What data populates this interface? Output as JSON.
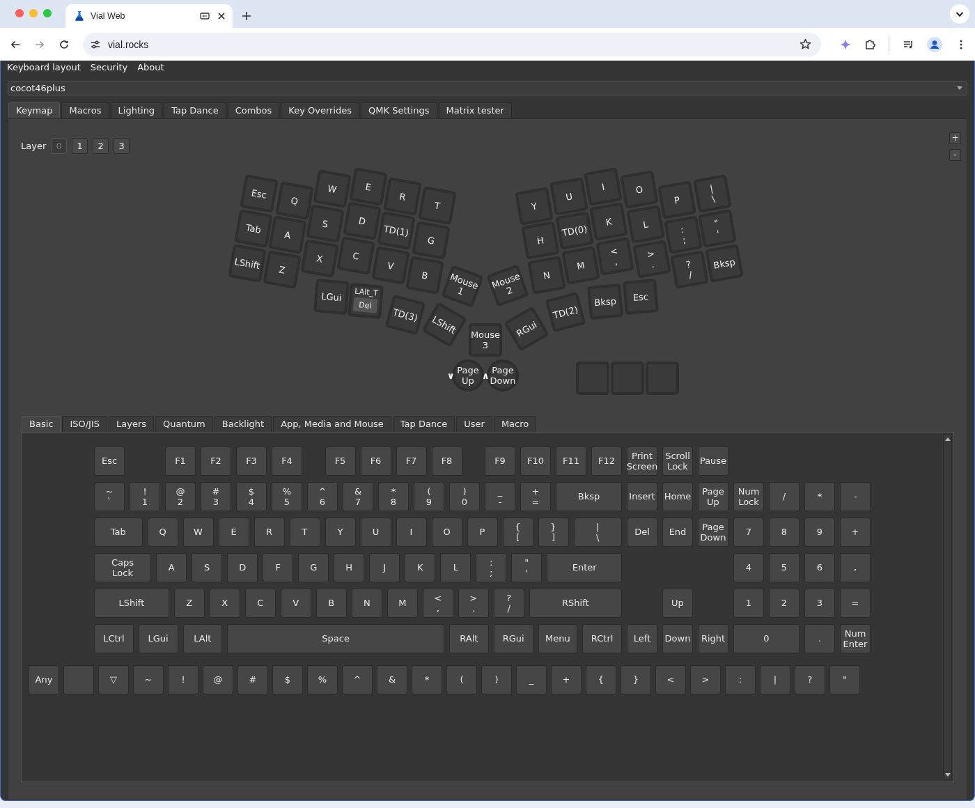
{
  "browser": {
    "tab_title": "Vial Web",
    "url": "vial.rocks"
  },
  "menu": [
    "Keyboard layout",
    "Security",
    "About"
  ],
  "keyboard_select": {
    "value": "cocot46plus"
  },
  "tabs": [
    {
      "label": "Keymap",
      "selected": true
    },
    {
      "label": "Macros",
      "selected": false
    },
    {
      "label": "Lighting",
      "selected": false
    },
    {
      "label": "Tap Dance",
      "selected": false
    },
    {
      "label": "Combos",
      "selected": false
    },
    {
      "label": "Key Overrides",
      "selected": false
    },
    {
      "label": "QMK Settings",
      "selected": false
    },
    {
      "label": "Matrix tester",
      "selected": false
    }
  ],
  "layers": {
    "label": "Layer",
    "buttons": [
      {
        "label": "0",
        "selected": true
      },
      {
        "label": "1",
        "selected": false
      },
      {
        "label": "2",
        "selected": false
      },
      {
        "label": "3",
        "selected": false
      }
    ]
  },
  "zoom_buttons": [
    "+",
    "-"
  ],
  "layout_keys": [
    {
      "kind": "key",
      "label": "Esc"
    },
    {
      "kind": "key",
      "label": "Q"
    },
    {
      "kind": "key",
      "label": "W"
    },
    {
      "kind": "key",
      "label": "E"
    },
    {
      "kind": "key",
      "label": "R"
    },
    {
      "kind": "key",
      "label": "T"
    },
    {
      "kind": "key",
      "label": "Tab"
    },
    {
      "kind": "key",
      "label": "A"
    },
    {
      "kind": "key",
      "label": "S"
    },
    {
      "kind": "key",
      "label": "D"
    },
    {
      "kind": "key",
      "label": "TD(1)"
    },
    {
      "kind": "key",
      "label": "G"
    },
    {
      "kind": "key",
      "label": "LShift"
    },
    {
      "kind": "key",
      "label": "Z"
    },
    {
      "kind": "key",
      "label": "X"
    },
    {
      "kind": "key",
      "label": "C"
    },
    {
      "kind": "key",
      "label": "V"
    },
    {
      "kind": "key",
      "label": "B"
    },
    {
      "kind": "key",
      "label": "Mouse\n1"
    },
    {
      "kind": "key",
      "label": "LGui"
    },
    {
      "kind": "modtap",
      "label": "LAlt_T",
      "tap": "Del"
    },
    {
      "kind": "key",
      "label": "TD(3)"
    },
    {
      "kind": "key",
      "label": "LShift"
    },
    {
      "kind": "key",
      "label": "Mouse\n3"
    },
    {
      "kind": "key",
      "label": "Y"
    },
    {
      "kind": "key",
      "label": "U"
    },
    {
      "kind": "key",
      "label": "I"
    },
    {
      "kind": "key",
      "label": "O"
    },
    {
      "kind": "key",
      "label": "P"
    },
    {
      "kind": "key",
      "label": "|\n\\"
    },
    {
      "kind": "key",
      "label": "H"
    },
    {
      "kind": "key",
      "label": "TD(0)"
    },
    {
      "kind": "key",
      "label": "K"
    },
    {
      "kind": "key",
      "label": "L"
    },
    {
      "kind": "key",
      "label": ":\n;"
    },
    {
      "kind": "key",
      "label": "\"\n'"
    },
    {
      "kind": "key",
      "label": "N"
    },
    {
      "kind": "key",
      "label": "M"
    },
    {
      "kind": "key",
      "label": "<\n,"
    },
    {
      "kind": "key",
      "label": ">\n."
    },
    {
      "kind": "key",
      "label": "?\n/"
    },
    {
      "kind": "key",
      "label": "Bksp"
    },
    {
      "kind": "key",
      "label": "Mouse\n2"
    },
    {
      "kind": "key",
      "label": "RGui"
    },
    {
      "kind": "key",
      "label": "TD(2)"
    },
    {
      "kind": "key",
      "label": "Bksp"
    },
    {
      "kind": "key",
      "label": "Esc"
    },
    {
      "kind": "encoder",
      "label": "Page\nUp",
      "arrow": "∨"
    },
    {
      "kind": "encoder",
      "label": "Page\nDown",
      "arrow": "∧"
    },
    {
      "kind": "blank"
    },
    {
      "kind": "blank"
    },
    {
      "kind": "blank"
    }
  ],
  "keycode_tabs": [
    {
      "label": "Basic",
      "selected": true
    },
    {
      "label": "ISO/JIS",
      "selected": false
    },
    {
      "label": "Layers",
      "selected": false
    },
    {
      "label": "Quantum",
      "selected": false
    },
    {
      "label": "Backlight",
      "selected": false
    },
    {
      "label": "App, Media and Mouse",
      "selected": false
    },
    {
      "label": "Tap Dance",
      "selected": false
    },
    {
      "label": "User",
      "selected": false
    },
    {
      "label": "Macro",
      "selected": false
    }
  ],
  "keycode_rows": [
    [
      "Esc",
      "F1",
      "F2",
      "F3",
      "F4",
      "F5",
      "F6",
      "F7",
      "F8",
      "F9",
      "F10",
      "F11",
      "F12",
      "Print\nScreen",
      "Scroll\nLock",
      "Pause"
    ],
    [
      "~\n`",
      "!\n1",
      "@\n2",
      "#\n3",
      "$\n4",
      "%\n5",
      "^\n6",
      "&\n7",
      "*\n8",
      "(\n9",
      ")\n0",
      "_\n-",
      "+\n=",
      "Bksp",
      "Insert",
      "Home",
      "Page\nUp",
      "Num\nLock",
      "/",
      "*",
      "-"
    ],
    [
      "Tab",
      "Q",
      "W",
      "E",
      "R",
      "T",
      "Y",
      "U",
      "I",
      "O",
      "P",
      "{\n[",
      "}\n]",
      "|\n\\",
      "Del",
      "End",
      "Page\nDown",
      "7",
      "8",
      "9",
      "+"
    ],
    [
      "Caps\nLock",
      "A",
      "S",
      "D",
      "F",
      "G",
      "H",
      "J",
      "K",
      "L",
      ":\n;",
      "\"\n'",
      "Enter",
      "4",
      "5",
      "6",
      ","
    ],
    [
      "LShift",
      "Z",
      "X",
      "C",
      "V",
      "B",
      "N",
      "M",
      "<\n,",
      ">\n.",
      "?\n/",
      "RShift",
      "Up",
      "1",
      "2",
      "3",
      "="
    ],
    [
      "LCtrl",
      "LGui",
      "LAlt",
      "Space",
      "RAlt",
      "RGui",
      "Menu",
      "RCtrl",
      "Left",
      "Down",
      "Right",
      "0",
      ".",
      "Num\nEnter"
    ]
  ],
  "extra_keys": [
    {
      "kind": "key",
      "label": "Any"
    },
    {
      "kind": "blank"
    },
    {
      "kind": "key",
      "label": "▽"
    },
    {
      "kind": "key",
      "label": "~"
    },
    {
      "kind": "key",
      "label": "!"
    },
    {
      "kind": "key",
      "label": "@"
    },
    {
      "kind": "key",
      "label": "#"
    },
    {
      "kind": "key",
      "label": "$"
    },
    {
      "kind": "key",
      "label": "%"
    },
    {
      "kind": "key",
      "label": "^"
    },
    {
      "kind": "key",
      "label": "&"
    },
    {
      "kind": "key",
      "label": "*"
    },
    {
      "kind": "key",
      "label": "("
    },
    {
      "kind": "key",
      "label": ")"
    },
    {
      "kind": "key",
      "label": "_"
    },
    {
      "kind": "key",
      "label": "+"
    },
    {
      "kind": "key",
      "label": "{"
    },
    {
      "kind": "key",
      "label": "}"
    },
    {
      "kind": "key",
      "label": "<"
    },
    {
      "kind": "key",
      "label": ">"
    },
    {
      "kind": "key",
      "label": ":"
    },
    {
      "kind": "key",
      "label": "|"
    },
    {
      "kind": "key",
      "label": "?"
    },
    {
      "kind": "key",
      "label": "\""
    }
  ]
}
